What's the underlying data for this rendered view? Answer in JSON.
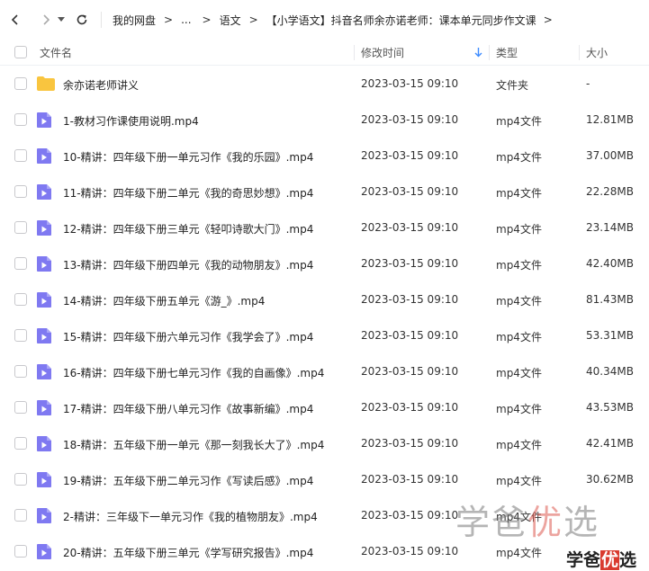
{
  "breadcrumb": [
    "我的网盘",
    "...",
    "语文",
    "【小学语文】抖音名师余亦诺老师：课本单元同步作文课"
  ],
  "breadcrumb_sep": ">",
  "columns": {
    "name": "文件名",
    "time": "修改时间",
    "type": "类型",
    "size": "大小"
  },
  "icons": {
    "back": "back-arrow-icon",
    "forward": "forward-arrow-icon",
    "dropdown": "dropdown-caret-icon",
    "refresh": "refresh-icon",
    "folder": "folder-icon",
    "video": "video-file-icon",
    "sort": "sort-down-arrow-icon"
  },
  "colors": {
    "folder": "#f9c53f",
    "video": "#7f79f1",
    "sort_arrow": "#3d8bff"
  },
  "files": [
    {
      "name": "余亦诺老师讲义",
      "time": "2023-03-15 09:10",
      "type": "文件夹",
      "size": "-",
      "kind": "folder"
    },
    {
      "name": "1-教材习作课使用说明.mp4",
      "time": "2023-03-15 09:10",
      "type": "mp4文件",
      "size": "12.81MB",
      "kind": "video"
    },
    {
      "name": "10-精讲：四年级下册一单元习作《我的乐园》.mp4",
      "time": "2023-03-15 09:10",
      "type": "mp4文件",
      "size": "37.00MB",
      "kind": "video"
    },
    {
      "name": "11-精讲：四年级下册二单元《我的奇思妙想》.mp4",
      "time": "2023-03-15 09:10",
      "type": "mp4文件",
      "size": "22.28MB",
      "kind": "video"
    },
    {
      "name": "12-精讲：四年级下册三单元《轻叩诗歌大门》.mp4",
      "time": "2023-03-15 09:10",
      "type": "mp4文件",
      "size": "23.14MB",
      "kind": "video"
    },
    {
      "name": "13-精讲：四年级下册四单元《我的动物朋友》.mp4",
      "time": "2023-03-15 09:10",
      "type": "mp4文件",
      "size": "42.40MB",
      "kind": "video"
    },
    {
      "name": "14-精讲：四年级下册五单元《游_》.mp4",
      "time": "2023-03-15 09:10",
      "type": "mp4文件",
      "size": "81.43MB",
      "kind": "video"
    },
    {
      "name": "15-精讲：四年级下册六单元习作《我学会了》.mp4",
      "time": "2023-03-15 09:10",
      "type": "mp4文件",
      "size": "53.31MB",
      "kind": "video"
    },
    {
      "name": "16-精讲：四年级下册七单元习作《我的自画像》.mp4",
      "time": "2023-03-15 09:10",
      "type": "mp4文件",
      "size": "40.34MB",
      "kind": "video"
    },
    {
      "name": "17-精讲：四年级下册八单元习作《故事新编》.mp4",
      "time": "2023-03-15 09:10",
      "type": "mp4文件",
      "size": "43.53MB",
      "kind": "video"
    },
    {
      "name": "18-精讲：五年级下册一单元《那一刻我长大了》.mp4",
      "time": "2023-03-15 09:10",
      "type": "mp4文件",
      "size": "42.41MB",
      "kind": "video"
    },
    {
      "name": "19-精讲：五年级下册二单元习作《写读后感》.mp4",
      "time": "2023-03-15 09:10",
      "type": "mp4文件",
      "size": "30.62MB",
      "kind": "video"
    },
    {
      "name": "2-精讲：三年级下一单元习作《我的植物朋友》.mp4",
      "time": "2023-03-15 09:10",
      "type": "mp4文件",
      "size": "",
      "kind": "video"
    },
    {
      "name": "20-精讲：五年级下册三单元《学写研究报告》.mp4",
      "time": "2023-03-15 09:10",
      "type": "mp4文件",
      "size": "",
      "kind": "video"
    }
  ],
  "watermark": {
    "prefix": "学爸",
    "highlight": "优",
    "suffix": "选"
  },
  "watermark2": {
    "prefix": "学爸",
    "highlight": "优",
    "suffix": "选"
  }
}
